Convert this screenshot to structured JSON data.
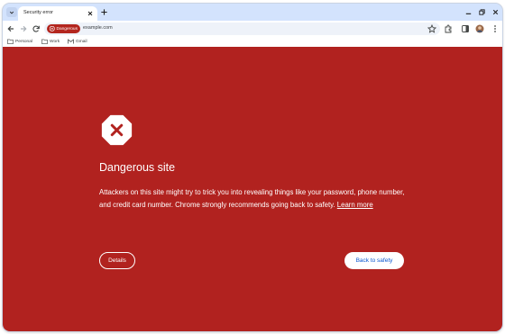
{
  "tab": {
    "title": "Security error"
  },
  "omnibox": {
    "chip_label": "Dangerous",
    "url": "example.com"
  },
  "bookmarks": [
    {
      "label": "Personal",
      "icon": "folder-icon"
    },
    {
      "label": "Work",
      "icon": "folder-icon"
    },
    {
      "label": "Gmail",
      "icon": "gmail-icon"
    }
  ],
  "interstitial": {
    "heading": "Dangerous site",
    "body": "Attackers on this site might try to trick you into revealing things like your password, phone number, and credit card number. Chrome strongly recommends going back to safety.",
    "learn_more": "Learn more",
    "details_label": "Details",
    "back_label": "Back to safety"
  },
  "colors": {
    "danger_background": "#b1221f",
    "chip_background": "#b3261e",
    "tabstrip": "#d3e3fd",
    "primary_button_text": "#0b57d0"
  }
}
